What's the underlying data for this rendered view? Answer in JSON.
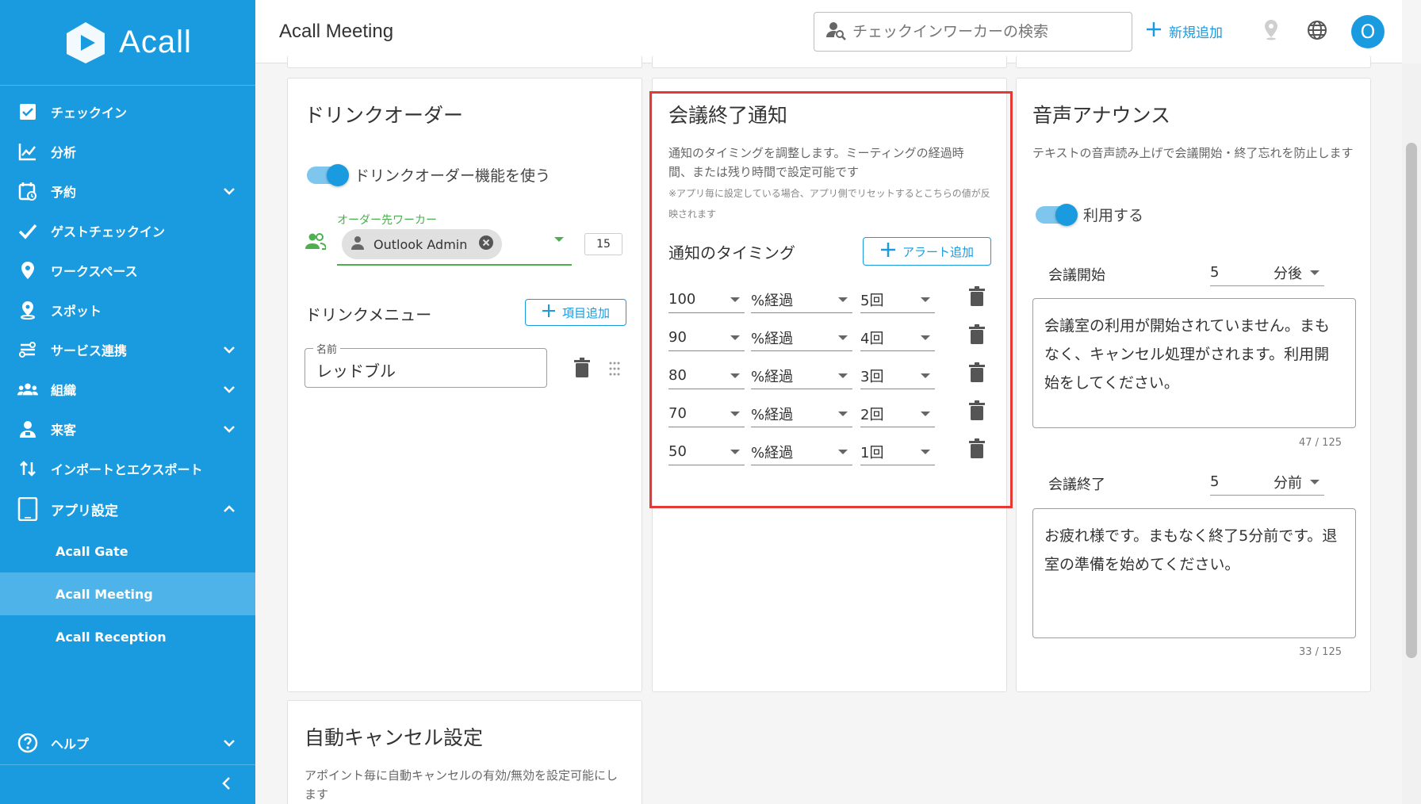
{
  "brand": {
    "logo_text": "Acall"
  },
  "sidebar": {
    "items": [
      {
        "label": "チェックイン",
        "icon": "checkbox-icon",
        "expandable": false
      },
      {
        "label": "分析",
        "icon": "chart-icon",
        "expandable": false
      },
      {
        "label": "予約",
        "icon": "calendar-icon",
        "expandable": true
      },
      {
        "label": "ゲストチェックイン",
        "icon": "check-icon",
        "expandable": false
      },
      {
        "label": "ワークスペース",
        "icon": "location-pin-icon",
        "expandable": false
      },
      {
        "label": "スポット",
        "icon": "spot-pin-icon",
        "expandable": false
      },
      {
        "label": "サービス連携",
        "icon": "integration-icon",
        "expandable": true
      },
      {
        "label": "組織",
        "icon": "group-icon",
        "expandable": true
      },
      {
        "label": "来客",
        "icon": "visitor-icon",
        "expandable": true
      },
      {
        "label": "インポートとエクスポート",
        "icon": "import-export-icon",
        "expandable": false
      },
      {
        "label": "アプリ設定",
        "icon": "tablet-icon",
        "expandable": true,
        "expanded": true
      }
    ],
    "sub_items": [
      {
        "label": "Acall Gate",
        "active": false
      },
      {
        "label": "Acall Meeting",
        "active": true
      },
      {
        "label": "Acall Reception",
        "active": false
      }
    ],
    "help_label": "ヘルプ"
  },
  "header": {
    "title": "Acall Meeting",
    "search_placeholder": "チェックインワーカーの検索",
    "add_new_label": "新規追加",
    "avatar_initial": "O"
  },
  "drink_order": {
    "title": "ドリンクオーダー",
    "toggle_label": "ドリンクオーダー機能を使う",
    "worker_field_label": "オーダー先ワーカー",
    "worker_chip": "Outlook Admin",
    "quantity": "15",
    "menu_title": "ドリンクメニュー",
    "add_item_label": "項目追加",
    "name_field_label": "名前",
    "name_value": "レッドブル"
  },
  "meeting_end": {
    "title": "会議終了通知",
    "description": "通知のタイミングを調整します。ミーティングの経過時間、または残り時間で設定可能です",
    "note": "※アプリ毎に設定している場合、アプリ側でリセットするとこちらの値が反映されます",
    "timing_label": "通知のタイミング",
    "add_alert_label": "アラート追加",
    "rows": [
      {
        "value": "100",
        "unit": "%経過",
        "count": "5回"
      },
      {
        "value": "90",
        "unit": "%経過",
        "count": "4回"
      },
      {
        "value": "80",
        "unit": "%経過",
        "count": "3回"
      },
      {
        "value": "70",
        "unit": "%経過",
        "count": "2回"
      },
      {
        "value": "50",
        "unit": "%経過",
        "count": "1回"
      }
    ]
  },
  "voice": {
    "title": "音声アナウンス",
    "description": "テキストの音声読み上げで会議開始・終了忘れを防止します",
    "toggle_label": "利用する",
    "start_label": "会議開始",
    "start_value": "5",
    "start_unit": "分後",
    "start_text": "会議室の利用が開始されていません。まもなく、キャンセル処理がされます。利用開始をしてください。",
    "start_count": "47 / 125",
    "end_label": "会議終了",
    "end_value": "5",
    "end_unit": "分前",
    "end_text": "お疲れ様です。まもなく終了5分前です。退室の準備を始めてください。",
    "end_count": "33 / 125"
  },
  "auto_cancel": {
    "title": "自動キャンセル設定",
    "description": "アポイント毎に自動キャンセルの有効/無効を設定可能にします"
  },
  "colors": {
    "primary": "#1a9be0",
    "active_sub": "#4eb3e9",
    "highlight": "#e53935",
    "green": "#4caf50"
  }
}
